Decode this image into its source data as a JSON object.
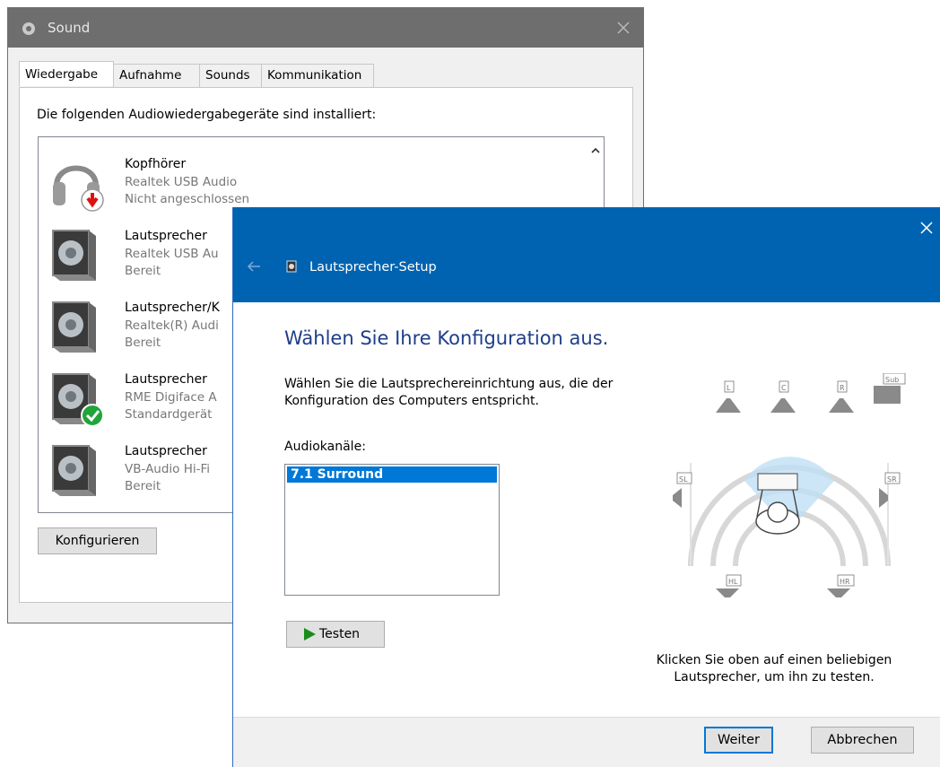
{
  "sound_window": {
    "title": "Sound",
    "tabs": [
      {
        "label": "Wiedergabe",
        "active": true
      },
      {
        "label": "Aufnahme",
        "active": false
      },
      {
        "label": "Sounds",
        "active": false
      },
      {
        "label": "Kommunikation",
        "active": false
      }
    ],
    "description": "Die folgenden Audiowiedergabegeräte sind installiert:",
    "devices": [
      {
        "name": "Kopfhörer",
        "driver": "Realtek USB Audio",
        "status": "Nicht angeschlossen",
        "icon": "headphones-icon",
        "badge": "unplugged-badge-icon"
      },
      {
        "name": "Lautsprecher",
        "driver": "Realtek USB Au",
        "status": "Bereit",
        "icon": "speaker-icon",
        "badge": ""
      },
      {
        "name": "Lautsprecher/K",
        "driver": "Realtek(R) Audi",
        "status": "Bereit",
        "icon": "speaker-icon",
        "badge": ""
      },
      {
        "name": "Lautsprecher",
        "driver": "RME Digiface A",
        "status": "Standardgerät",
        "icon": "speaker-icon",
        "badge": "default-check-icon"
      },
      {
        "name": "Lautsprecher",
        "driver": "VB-Audio Hi-Fi",
        "status": "Bereit",
        "icon": "speaker-icon",
        "badge": ""
      }
    ],
    "configure_label": "Konfigurieren"
  },
  "wizard": {
    "title": "Lautsprecher-Setup",
    "heading": "Wählen Sie Ihre Konfiguration aus.",
    "instruction": "Wählen Sie die Lautsprechereinrichtung aus, die der Konfiguration des Computers entspricht.",
    "channels_label": "Audiokanäle:",
    "channels": [
      "7.1 Surround"
    ],
    "selected_channel": "7.1 Surround",
    "test_label": "Testen",
    "speaker_labels": {
      "L": "L",
      "C": "C",
      "R": "R",
      "Sub": "Sub",
      "SL": "SL",
      "SR": "SR",
      "HL": "HL",
      "HR": "HR"
    },
    "hint": "Klicken Sie oben auf einen beliebigen Lautsprecher, um ihn zu testen.",
    "next_label": "Weiter",
    "cancel_label": "Abbrechen"
  },
  "colors": {
    "wizard_header": "#0063b1",
    "heading_text": "#1e3e8a",
    "selection": "#0078d7",
    "sound_titlebar": "#6e6e6e"
  }
}
